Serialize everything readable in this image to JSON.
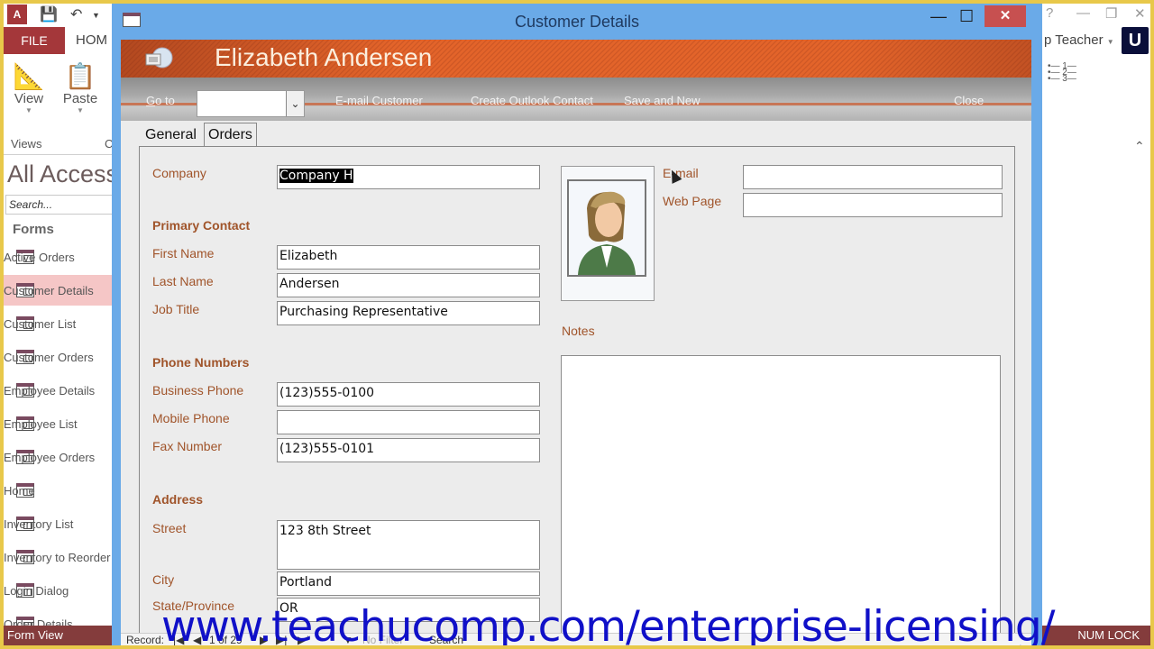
{
  "access": {
    "qat_icons": [
      "access-logo",
      "save-icon",
      "undo-icon"
    ],
    "logo_text": "A",
    "tabs": {
      "file": "FILE",
      "home": "HOM"
    },
    "ribbon": {
      "view_label": "View",
      "paste_label": "Paste",
      "views_group": "Views",
      "clipboard_group": "C"
    },
    "nav": {
      "title": "All Access",
      "search_placeholder": "Search...",
      "section": "Forms",
      "items": [
        {
          "label": "Active Orders",
          "selected": false
        },
        {
          "label": "Customer Details",
          "selected": true
        },
        {
          "label": "Customer List",
          "selected": false
        },
        {
          "label": "Customer Orders",
          "selected": false
        },
        {
          "label": "Employee Details",
          "selected": false
        },
        {
          "label": "Employee List",
          "selected": false
        },
        {
          "label": "Employee Orders",
          "selected": false
        },
        {
          "label": "Home",
          "selected": false
        },
        {
          "label": "Inventory List",
          "selected": false
        },
        {
          "label": "Inventory to Reorder",
          "selected": false
        },
        {
          "label": "Login Dialog",
          "selected": false
        },
        {
          "label": "Order Details",
          "selected": false
        }
      ]
    },
    "right": {
      "help": "?",
      "user": "p Teacher",
      "badge": "U"
    },
    "status": {
      "left": "Form View",
      "right": "NUM LOCK"
    }
  },
  "dialog": {
    "title": "Customer Details",
    "header_name": "Elizabeth Andersen",
    "toolbar": {
      "goto_label": "Go to",
      "goto_value": "",
      "email_customer": "E-mail Customer",
      "create_outlook": "Create Outlook Contact",
      "save_new": "Save and New",
      "close": "Close"
    },
    "tabs": [
      "General",
      "Orders"
    ],
    "active_tab": "General",
    "fields": {
      "company": {
        "label": "Company",
        "value": "Company H"
      },
      "primary_contact": "Primary Contact",
      "first_name": {
        "label": "First Name",
        "value": "Elizabeth"
      },
      "last_name": {
        "label": "Last Name",
        "value": "Andersen"
      },
      "job_title": {
        "label": "Job Title",
        "value": "Purchasing Representative"
      },
      "phone_numbers": "Phone Numbers",
      "business_phone": {
        "label": "Business Phone",
        "value": "(123)555-0100"
      },
      "mobile_phone": {
        "label": "Mobile Phone",
        "value": ""
      },
      "fax_number": {
        "label": "Fax Number",
        "value": "(123)555-0101"
      },
      "address": "Address",
      "street": {
        "label": "Street",
        "value": "123 8th Street"
      },
      "city": {
        "label": "City",
        "value": "Portland"
      },
      "state": {
        "label": "State/Province",
        "value": "OR"
      },
      "email": {
        "label": "E-mail",
        "value": ""
      },
      "web_page": {
        "label": "Web Page",
        "value": ""
      },
      "notes": {
        "label": "Notes",
        "value": ""
      }
    },
    "record_nav": {
      "label": "Record:",
      "position": "1 of 29",
      "filter": "No Filter",
      "search": "Search"
    }
  },
  "watermark": "www.teachucomp.com/enterprise-licensing/",
  "colors": {
    "accent": "#a4373a",
    "label": "#a0542a",
    "header_orange": "#e3642a",
    "window_blue": "#6aaae8",
    "watermark": "#1010c8"
  }
}
